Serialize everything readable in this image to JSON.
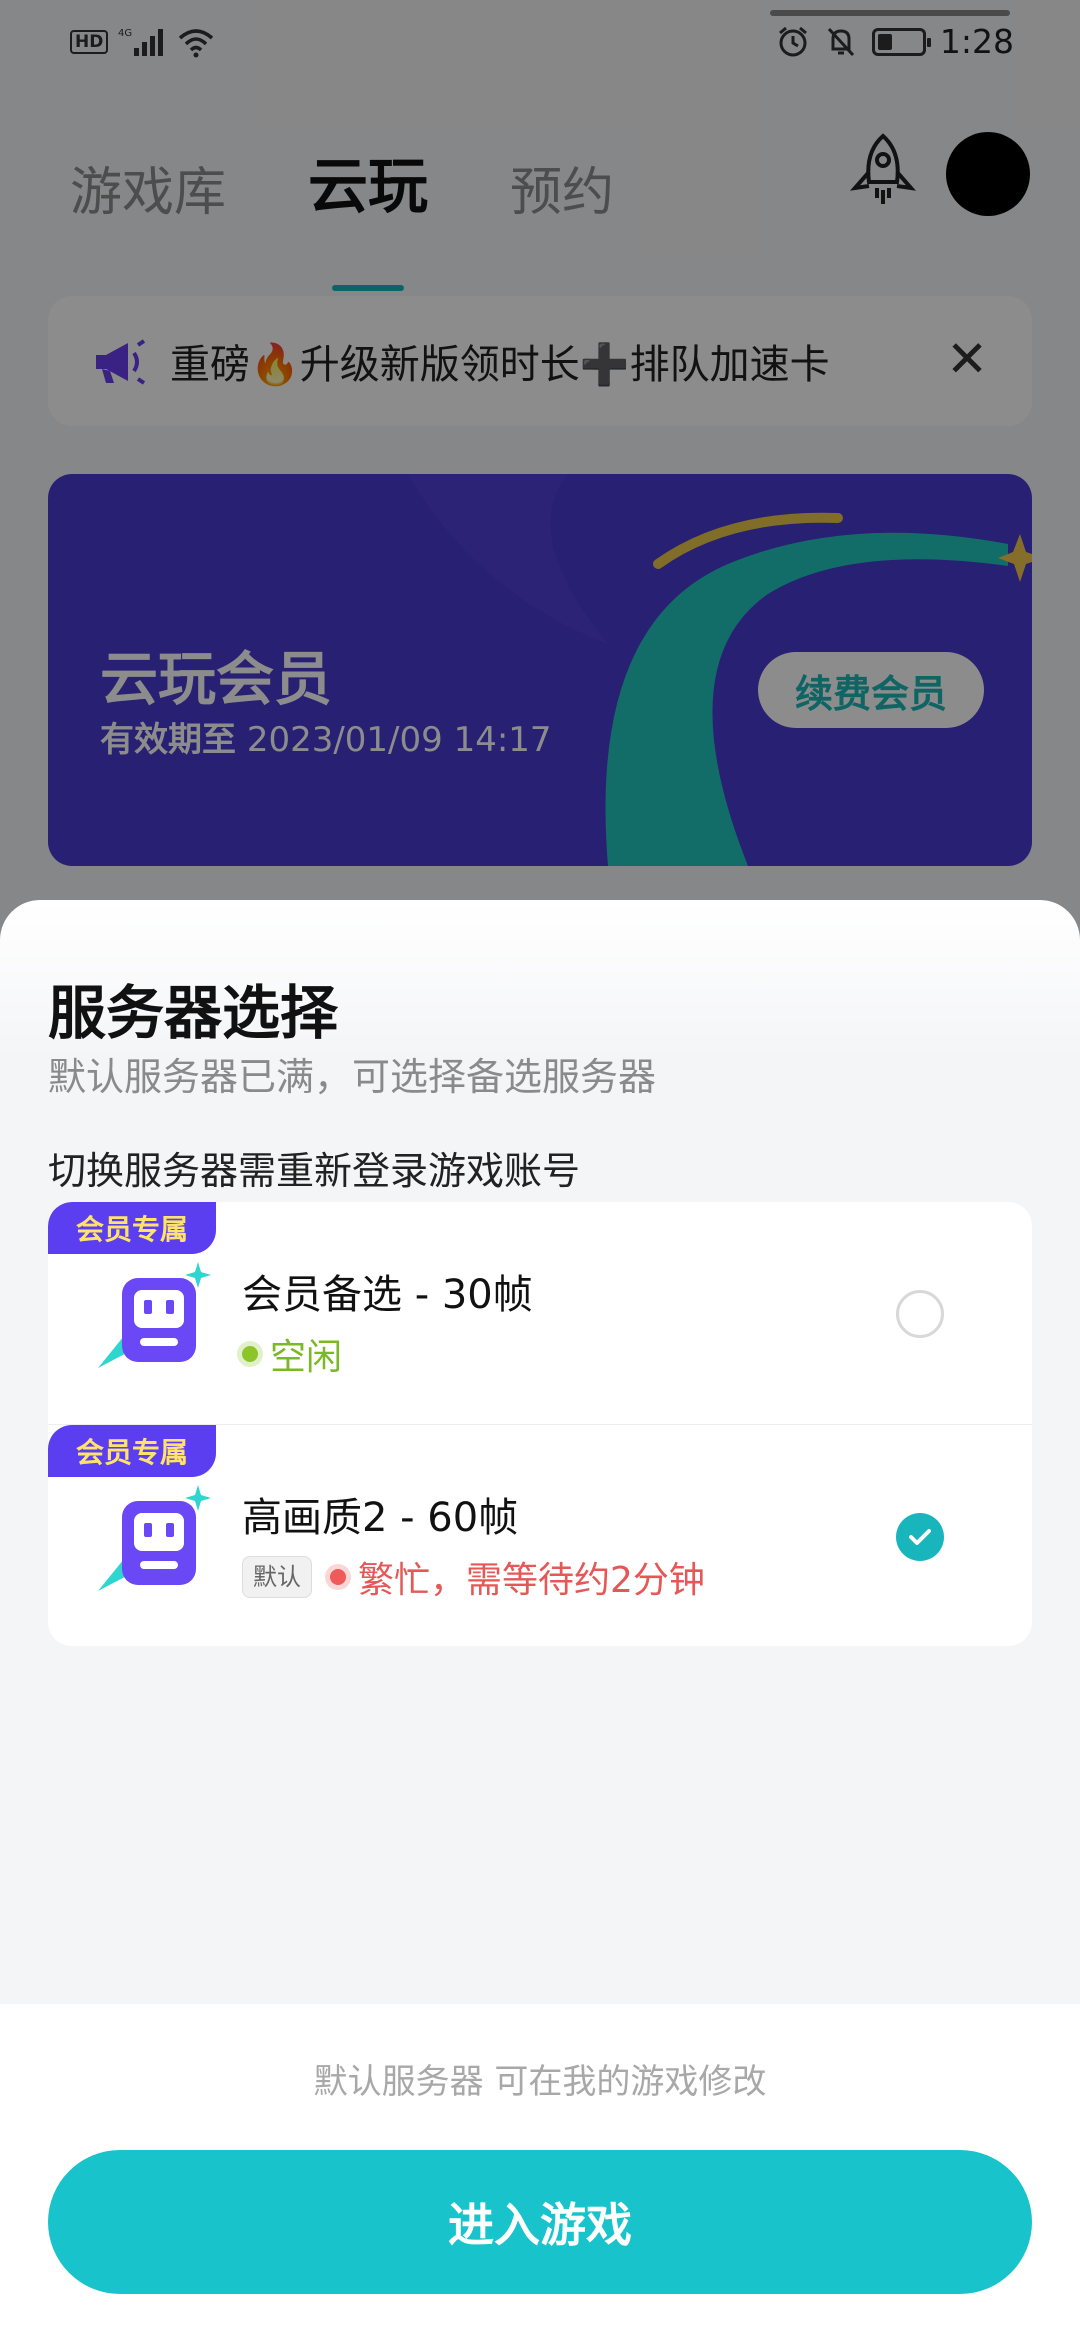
{
  "status_bar": {
    "hd": "HD",
    "network": "4G",
    "time": "1:28",
    "icons": [
      "hd-icon",
      "signal-icon",
      "wifi-icon",
      "alarm-icon",
      "mute-icon",
      "battery-icon"
    ]
  },
  "header": {
    "tabs": [
      {
        "label": "游戏库",
        "active": false
      },
      {
        "label": "云玩",
        "active": true
      },
      {
        "label": "预约",
        "active": false
      }
    ],
    "rocket_icon": "rocket-icon",
    "avatar": "avatar"
  },
  "notice": {
    "text": "重磅🔥升级新版领时长➕排队加速卡",
    "icon": "megaphone-icon",
    "close": "✕"
  },
  "vip_card": {
    "title": "云玩会员",
    "expiry_label": "有效期至",
    "expiry_value": "2023/01/09 14:17",
    "renew_button": "续费会员"
  },
  "sheet": {
    "title": "服务器选择",
    "subtitle": "默认服务器已满，可选择备选服务器",
    "note": "切换服务器需重新登录游戏账号",
    "servers": [
      {
        "badge": "会员专属",
        "name": "会员备选 - 30帧",
        "status": "空闲",
        "status_color": "#7ab824",
        "selected": false
      },
      {
        "badge": "会员专属",
        "name": "高画质2 - 60帧",
        "tag": "默认",
        "status": "繁忙，需等待约2分钟",
        "status_color": "#e65757",
        "selected": true
      }
    ],
    "footer_hint": "默认服务器 可在我的游戏修改",
    "enter_button": "进入游戏"
  },
  "colors": {
    "accent": "#19c3cc",
    "badge_bg": "#5b3ef0",
    "badge_text": "#ffe26a",
    "vip_bg": "#4a3bd0"
  }
}
